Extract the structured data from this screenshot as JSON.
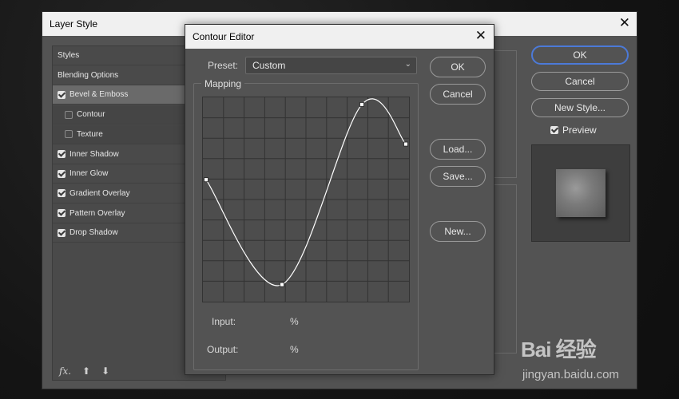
{
  "layer_style": {
    "title": "Layer Style",
    "close_glyph": "✕",
    "styles": [
      {
        "label": "Styles",
        "type": "header",
        "checked": null
      },
      {
        "label": "Blending Options",
        "type": "header",
        "checked": null
      },
      {
        "label": "Bevel & Emboss",
        "type": "item",
        "checked": true,
        "selected": true
      },
      {
        "label": "Contour",
        "type": "sub",
        "checked": false
      },
      {
        "label": "Texture",
        "type": "sub",
        "checked": false
      },
      {
        "label": "Inner Shadow",
        "type": "item",
        "checked": true
      },
      {
        "label": "Inner Glow",
        "type": "item",
        "checked": true
      },
      {
        "label": "Gradient Overlay",
        "type": "item",
        "checked": true
      },
      {
        "label": "Pattern Overlay",
        "type": "item",
        "checked": true
      },
      {
        "label": "Drop Shadow",
        "type": "item",
        "checked": true
      }
    ],
    "fx_label": "fx.",
    "move_up_glyph": "⬆",
    "move_down_glyph": "⬇",
    "buttons": {
      "ok": "OK",
      "cancel": "Cancel",
      "new_style": "New Style..."
    },
    "preview_label": "Preview",
    "preview_checked": true
  },
  "contour_editor": {
    "title": "Contour Editor",
    "close_glyph": "✕",
    "preset_label": "Preset:",
    "preset_value": "Custom",
    "chevron_glyph": "⌄",
    "mapping_label": "Mapping",
    "input_label": "Input:",
    "input_value": "%",
    "output_label": "Output:",
    "output_value": "%",
    "buttons": {
      "ok": "OK",
      "cancel": "Cancel",
      "load": "Load...",
      "save": "Save...",
      "new": "New..."
    },
    "curve_points": [
      {
        "input": 0,
        "output": 60
      },
      {
        "input": 38,
        "output": 7
      },
      {
        "input": 78,
        "output": 98
      },
      {
        "input": 100,
        "output": 78
      }
    ]
  },
  "watermark": {
    "logo": "Bai 经验",
    "url": "jingyan.baidu.com"
  },
  "colors": {
    "accent_focus": "#4c7ad8",
    "dialog_bg": "#535353",
    "titlebar": "#f0f0f0",
    "curve": "#ffffff"
  }
}
